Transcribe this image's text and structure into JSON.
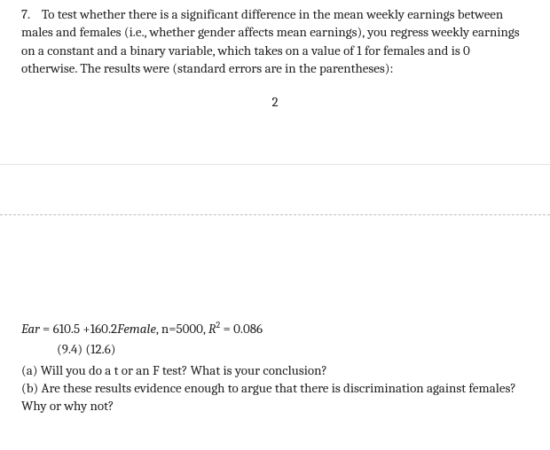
{
  "question": {
    "number": "7.",
    "intro": "To test whether there is a significant difference in the mean weekly earnings between males and females (i.e., whether gender affects mean earnings), you regress weekly earnings on a constant and a binary variable, which takes on a value of 1 for females and is 0 otherwise. The results were (standard errors are in the parentheses):"
  },
  "page_number": "2",
  "regression": {
    "lhs": "Ear",
    "eq": " = 610.5 +160.2",
    "dummy": "Female",
    "tail": ",   n=5000, ",
    "r2label": "R",
    "r2sup": "2",
    "r2val": " = 0.086",
    "se": "(9.4)   (12.6)"
  },
  "parts": {
    "a": "(a) Will you do a t or an F test? What is your conclusion?",
    "b": "(b) Are these results evidence enough to argue that there is discrimination against females? Why or why not?"
  }
}
